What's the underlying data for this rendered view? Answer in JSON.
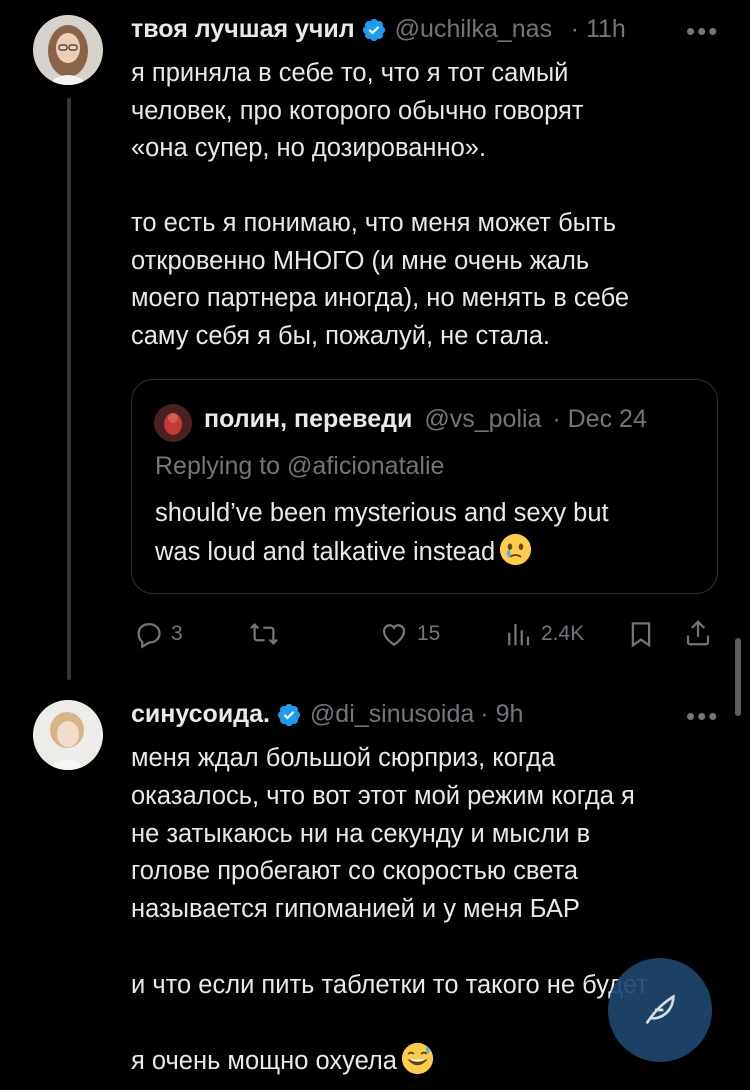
{
  "tweet1": {
    "name": "твоя лучшая учил",
    "handle": "@uchilka_nas",
    "time": "· 11h",
    "more": "•••",
    "text": "я приняла в себе то, что я тот самый\nчеловек, про которого обычно говорят\n«она супер, но дозированно».\n\nто есть я понимаю, что меня может быть\nоткровенно МНОГО (и мне очень жаль\nмоего партнера иногда), но менять в себе\nсаму себя я бы, пожалуй, не стала."
  },
  "quote": {
    "name": "полин, переведи",
    "handle": "@vs_polia",
    "time": "· Dec 24",
    "replying_prefix": "Replying to",
    "replying_to": "@aficionatalie",
    "text": "should’ve been mysterious and sexy but\nwas loud and talkative instead"
  },
  "actions": {
    "replies": "3",
    "retweets": "",
    "likes": "15",
    "views": "2.4K"
  },
  "tweet2": {
    "name": "синусоида.",
    "handle": "@di_sinusoida",
    "time": "· 9h",
    "more": "•••",
    "text": "меня ждал большой сюрприз, когда\nоказалось, что вот этот мой режим когда я\nне затыкаюсь ни на секунду и мысли в\nголове пробегают со скоростью света\nназывается гипоманией и у меня БАР\n\nи что если пить таблетки то такого не будет\n\nя очень мощно охуела"
  },
  "colors": {
    "background": "#000000",
    "text": "#e7e9ea",
    "muted": "#71767b",
    "verified": "#1d9bf0",
    "fab": "#1d486e"
  }
}
